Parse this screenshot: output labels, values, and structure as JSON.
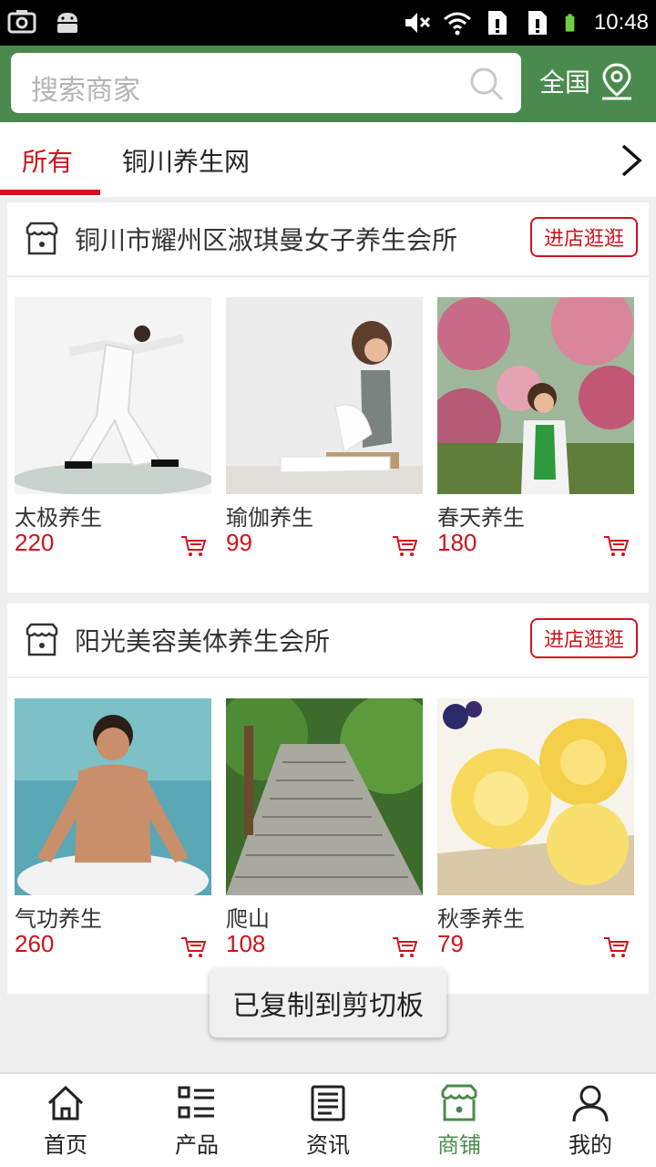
{
  "status_bar": {
    "time": "10:48"
  },
  "header": {
    "search_placeholder": "搜索商家",
    "region": "全国"
  },
  "tabs": [
    {
      "label": "所有"
    },
    {
      "label": "铜川养生网"
    }
  ],
  "stores": [
    {
      "name": "铜川市耀州区淑琪曼女子养生会所",
      "visit_label": "进店逛逛",
      "products": [
        {
          "name": "太极养生",
          "price": "220"
        },
        {
          "name": "瑜伽养生",
          "price": "99"
        },
        {
          "name": "春天养生",
          "price": "180"
        }
      ]
    },
    {
      "name": "阳光美容美体养生会所",
      "visit_label": "进店逛逛",
      "products": [
        {
          "name": "气功养生",
          "price": "260"
        },
        {
          "name": "爬山",
          "price": "108"
        },
        {
          "name": "秋季养生",
          "price": "79"
        }
      ]
    }
  ],
  "toast": "已复制到剪切板",
  "bottom_nav": [
    {
      "label": "首页",
      "icon": "home-icon"
    },
    {
      "label": "产品",
      "icon": "list-icon"
    },
    {
      "label": "资讯",
      "icon": "news-icon"
    },
    {
      "label": "商铺",
      "icon": "shop-icon",
      "active": true
    },
    {
      "label": "我的",
      "icon": "user-icon"
    }
  ],
  "colors": {
    "brand_green": "#4b8a4e",
    "accent_red": "#d0121b"
  }
}
